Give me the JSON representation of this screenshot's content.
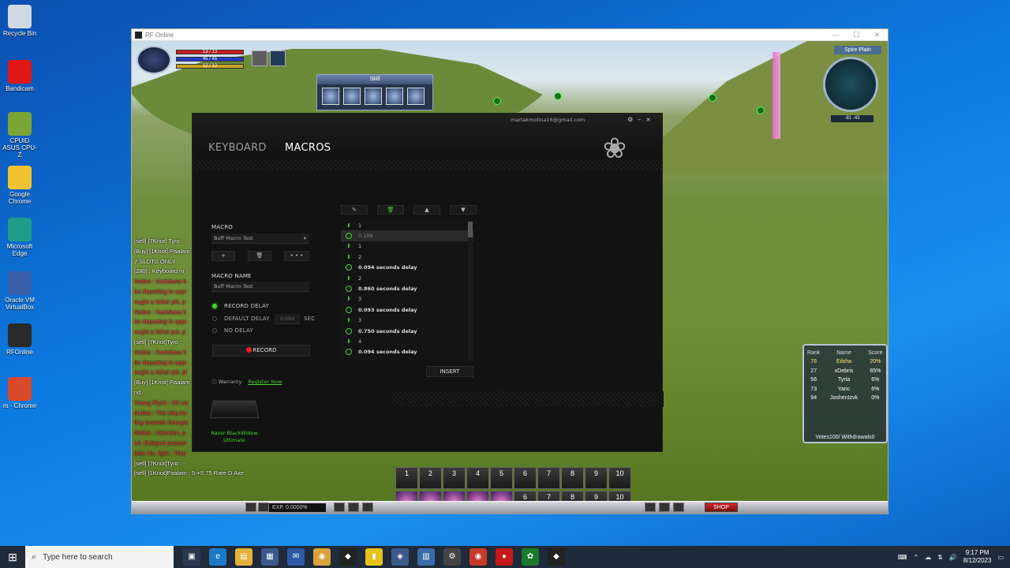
{
  "desktop": {
    "icons": [
      {
        "label": "Recycle Bin",
        "color": "#cfd8e4"
      },
      {
        "label": "Bandicam",
        "color": "#e01818"
      },
      {
        "label": "CPUID ASUS CPU-Z",
        "color": "#7aa535"
      },
      {
        "label": "Google Chrome",
        "color": "#f1c232"
      },
      {
        "label": "Microsoft Edge",
        "color": "#1f9d8a"
      },
      {
        "label": "Oracle VM VirtualBox",
        "color": "#3a5ea8"
      },
      {
        "label": "RFOnline",
        "color": "#2a2a2a"
      },
      {
        "label": "m - Chrome",
        "color": "#d94a2a"
      }
    ]
  },
  "window": {
    "title": "RF Online",
    "minimize": "—",
    "maximize": "☐",
    "close": "✕"
  },
  "game": {
    "hp": "13 / 13",
    "fp": "45 / 45",
    "sp": "12 / 12",
    "skill_title": "Skill",
    "minimap_title": "Spire Plain",
    "coords": "-81  -43",
    "chat": [
      {
        "text": "[sell] [7Knot] Tyro : -",
        "cls": "white"
      },
      {
        "text": "[Buy] [1Knot] Paalam",
        "cls": "white"
      },
      {
        "text": "7 SLOTS ONLY",
        "cls": "white"
      },
      {
        "text": "[280] : Keyboard m",
        "cls": "white"
      },
      {
        "text": "Notice : Kartelana h",
        "cls": "red"
      },
      {
        "text": "be departing in appr",
        "cls": "red"
      },
      {
        "text": "ought a ticket yet, p",
        "cls": "red"
      },
      {
        "text": "Notice : Kartelana h",
        "cls": "red"
      },
      {
        "text": "be departing in appr",
        "cls": "red"
      },
      {
        "text": "ought a ticket yet, p",
        "cls": "red"
      },
      {
        "text": "[sell] [7Knot]Tyro : -",
        "cls": "white"
      },
      {
        "text": "Notice : Kartelana h",
        "cls": "red"
      },
      {
        "text": "be departing in appr",
        "cls": "red"
      },
      {
        "text": "ought a ticket yet, pl",
        "cls": "red"
      },
      {
        "text": "[Buy] [1Knot] Paalam",
        "cls": "white"
      },
      {
        "text": "nd.",
        "cls": "white"
      },
      {
        "text": "Young Flynn : Oh no",
        "cls": "red"
      },
      {
        "text": "Notice : The ship ha",
        "cls": "red"
      },
      {
        "text": "ling towards Occupa",
        "cls": "red"
      },
      {
        "text": "Notice : Attention, p",
        "cls": "red"
      },
      {
        "text": "ed. Delayed passen",
        "cls": "red"
      },
      {
        "text": "bale Ho, fight : Thar",
        "cls": "red"
      },
      {
        "text": "[sell] [7Knot]Tyro : -",
        "cls": "white"
      },
      {
        "text": "[sell] [1Knot]Paalam : 5-+5 75 Rare D Axe",
        "cls": "white"
      }
    ],
    "ranking": {
      "headers": [
        "Rank",
        "Name",
        "Score"
      ],
      "rows": [
        [
          "76",
          "Eilsha",
          "20%"
        ],
        [
          "27",
          "xDebris",
          "65%"
        ],
        [
          "56",
          "Tyria",
          "6%"
        ],
        [
          "73",
          "Yaric",
          "6%"
        ],
        [
          "94",
          "JoshenIzvk",
          "0%"
        ]
      ],
      "votes": "Votes100/ Withdrawals0"
    },
    "hotbar_numbers": [
      "1",
      "2",
      "3",
      "4",
      "5",
      "6",
      "7",
      "8",
      "9",
      "10"
    ],
    "hotbar_lower": [
      "",
      "",
      "",
      "",
      "",
      "6",
      "7",
      "8",
      "9",
      "10"
    ],
    "exp": "EXP.  0.0000%",
    "shop": "SHOP"
  },
  "synapse": {
    "email": "martakmolina16@gmail.com",
    "tabs": {
      "keyboard": "KEYBOARD",
      "macros": "MACROS"
    },
    "macro_label": "MACRO",
    "macro_selected": "Buff Macro Test",
    "add_btn": "+",
    "delete_btn": "🗑",
    "more_btn": "• • •",
    "name_label": "MACRO NAME",
    "name_value": "Buff Macro Test",
    "record_delay": "RECORD DELAY",
    "default_delay": "DEFAULT DELAY",
    "default_delay_value": "0.050",
    "sec": "SEC",
    "no_delay": "NO DELAY",
    "record": "RECORD",
    "warranty": "Warranty",
    "register": "Register Now",
    "device": "Razer BlackWidow Ultimate",
    "insert": "INSERT",
    "tools": [
      "✎",
      "🗑",
      "▲",
      "▼"
    ],
    "items": [
      {
        "type": "down",
        "text": "1"
      },
      {
        "type": "delay",
        "text": "0.109",
        "sel": true
      },
      {
        "type": "up",
        "text": "1"
      },
      {
        "type": "down",
        "text": "2"
      },
      {
        "type": "delay",
        "text": "0.094 seconds delay"
      },
      {
        "type": "up",
        "text": "2"
      },
      {
        "type": "delay",
        "text": "0.860 seconds delay"
      },
      {
        "type": "down",
        "text": "3"
      },
      {
        "type": "delay",
        "text": "0.093 seconds delay"
      },
      {
        "type": "up",
        "text": "3"
      },
      {
        "type": "delay",
        "text": "0.750 seconds delay"
      },
      {
        "type": "down",
        "text": "4"
      },
      {
        "type": "delay",
        "text": "0.094 seconds delay"
      }
    ]
  },
  "taskbar": {
    "search_placeholder": "Type here to search",
    "time": "9:17 PM",
    "date": "8/12/2023"
  }
}
